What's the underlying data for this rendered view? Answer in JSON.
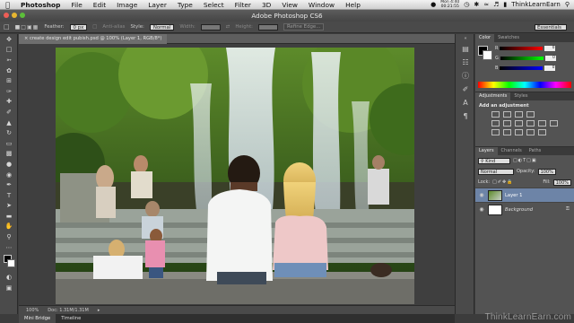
{
  "menubar": {
    "app_name": "Photoshop",
    "items": [
      "File",
      "Edit",
      "Image",
      "Layer",
      "Type",
      "Select",
      "Filter",
      "3D",
      "View",
      "Window",
      "Help"
    ],
    "clock": "Mon 4:40",
    "clock_sub": "00:21:55",
    "user": "ThinkLearnEarn"
  },
  "window": {
    "title": "Adobe Photoshop CS6"
  },
  "options": {
    "feather_label": "Feather:",
    "feather_value": "0 px",
    "antialias_label": "Anti-alias",
    "style_label": "Style:",
    "style_value": "Normal",
    "width_label": "Width:",
    "height_label": "Height:",
    "refine_edge": "Refine Edge...",
    "workspace": "Essentials"
  },
  "document": {
    "tab_title": "create design edit pubish.psd @ 100% (Layer 1, RGB/8*)",
    "zoom": "100%",
    "doc_size": "Doc: 1.31M/1.31M"
  },
  "bottom_tabs": [
    "Mini Bridge",
    "Timeline"
  ],
  "color_panel": {
    "tabs": [
      "Color",
      "Swatches"
    ],
    "channels": [
      {
        "label": "R",
        "value": "0"
      },
      {
        "label": "G",
        "value": "0"
      },
      {
        "label": "B",
        "value": "0"
      }
    ]
  },
  "adjustments_panel": {
    "tabs": [
      "Adjustments",
      "Styles"
    ],
    "heading": "Add an adjustment"
  },
  "layers_panel": {
    "tabs": [
      "Layers",
      "Channels",
      "Paths"
    ],
    "kind": "Kind",
    "blend_mode": "Normal",
    "opacity_label": "Opacity:",
    "opacity_value": "100%",
    "lock_label": "Lock:",
    "fill_label": "Fill:",
    "fill_value": "100%",
    "layers": [
      {
        "name": "Layer 1",
        "active": true
      },
      {
        "name": "Background",
        "active": false
      }
    ]
  },
  "watermark": "ThinkLearnEarn.com",
  "colors": {
    "accent_layer": "#6d84a7",
    "panel": "#535353",
    "canvas": "#3f3f3f"
  }
}
